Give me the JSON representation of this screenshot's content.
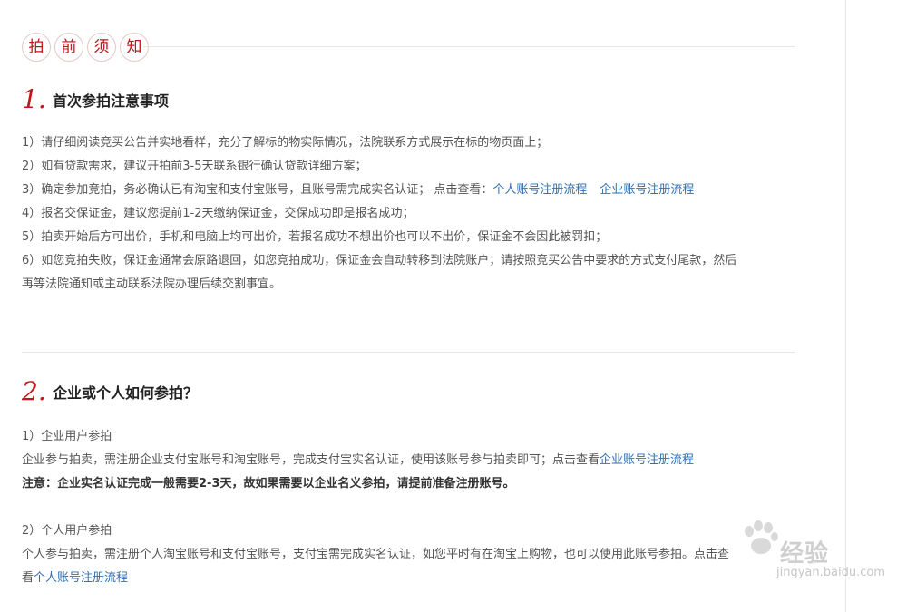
{
  "header": {
    "title_chars": [
      "拍",
      "前",
      "须",
      "知"
    ]
  },
  "section1": {
    "number": "1.",
    "title": "首次参拍注意事项",
    "items": [
      {
        "text": "1）请仔细阅读竞买公告并实地看样，充分了解标的物实际情况，法院联系方式展示在标的物页面上；"
      },
      {
        "text": "2）如有贷款需求，建议开拍前3-5天联系银行确认贷款详细方案；"
      },
      {
        "text": "3）确定参加竞拍，务必确认已有淘宝和支付宝账号，且账号需完成实名认证； 点击查看：",
        "link1": "个人账号注册流程",
        "link2": "企业账号注册流程"
      },
      {
        "text": "4）报名交保证金，建议您提前1-2天缴纳保证金，交保成功即是报名成功；"
      },
      {
        "text": "5）拍卖开始后方可出价，手机和电脑上均可出价，若报名成功不想出价也可以不出价，保证金不会因此被罚扣；"
      },
      {
        "text": "6）如您竞拍失败，保证金通常会原路退回，如您竞拍成功，保证金会自动转移到法院账户；请按照竞买公告中要求的方式支付尾款，然后"
      },
      {
        "text": "再等法院通知或主动联系法院办理后续交割事宜。"
      }
    ]
  },
  "section2": {
    "number": "2.",
    "title": "企业或个人如何参拍？",
    "enterprise": {
      "heading": "1）企业用户参拍",
      "text": "企业参与拍卖，需注册企业支付宝账号和淘宝账号，完成支付宝实名认证，使用该账号参与拍卖即可；点击查看",
      "link": "企业账号注册流程",
      "note": "注意：企业实名认证完成一般需要2-3天，故如果需要以企业名义参拍，请提前准备注册账号。"
    },
    "personal": {
      "heading": "2）个人用户参拍",
      "text": "个人参与拍卖，需注册个人淘宝账号和支付宝账号，支付宝需完成实名认证，如您平时有在淘宝上购物，也可以使用此账号参拍。点击查",
      "text2": "看",
      "link": "个人账号注册流程"
    }
  },
  "watermark": {
    "brand": "经验",
    "url": "jingyan.baidu.com"
  },
  "colors": {
    "accent": "#c2151b",
    "link": "#2f6fb3"
  }
}
